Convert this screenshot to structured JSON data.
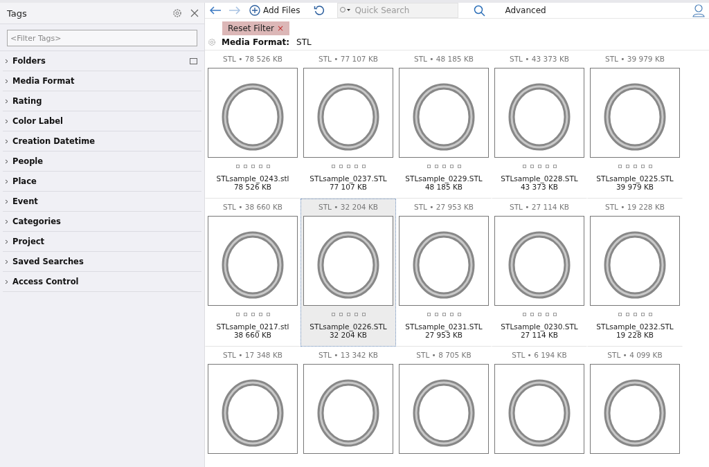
{
  "sidebar": {
    "title": "Tags",
    "filter_placeholder": "<Filter Tags>",
    "groups": [
      {
        "label": "Folders",
        "expanded": false
      },
      {
        "label": "Media Format",
        "expanded": false
      },
      {
        "label": "Rating",
        "expanded": false
      },
      {
        "label": "Color Label",
        "expanded": false
      },
      {
        "label": "Creation Datetime",
        "expanded": false
      },
      {
        "label": "People",
        "expanded": false
      },
      {
        "label": "Place",
        "expanded": false
      },
      {
        "label": "Event",
        "expanded": false
      },
      {
        "label": "Categories",
        "expanded": false
      },
      {
        "label": "Project",
        "expanded": false
      },
      {
        "label": "Saved Searches",
        "expanded": false
      },
      {
        "label": "Access Control",
        "expanded": false
      }
    ]
  },
  "toolbar": {
    "add_files": "Add Files",
    "search_placeholder": "Quick Search",
    "advanced": "Advanced"
  },
  "filter": {
    "reset": "Reset Filter",
    "close": "×",
    "label": "Media Format:",
    "value": "STL"
  },
  "items": [
    {
      "header": "STL • 78 526 KB",
      "name": "STLsample_0243.stl",
      "size": "78 526 KB",
      "stars": 0,
      "selected": false
    },
    {
      "header": "STL • 77 107 KB",
      "name": "STLsample_0237.STL",
      "size": "77 107 KB",
      "stars": 0,
      "selected": false
    },
    {
      "header": "STL • 48 185 KB",
      "name": "STLsample_0229.STL",
      "size": "48 185 KB",
      "stars": 0,
      "selected": false
    },
    {
      "header": "STL • 43 373 KB",
      "name": "STLsample_0228.STL",
      "size": "43 373 KB",
      "stars": 0,
      "selected": false
    },
    {
      "header": "STL • 39 979 KB",
      "name": "STLsample_0225.STL",
      "size": "39 979 KB",
      "stars": 0,
      "selected": false
    },
    {
      "header": "STL • 38 660 KB",
      "name": "STLsample_0217.stl",
      "size": "38 660 KB",
      "stars": 0,
      "selected": false
    },
    {
      "header": "STL • 32 204 KB",
      "name": "STLsample_0226.STL",
      "size": "32 204 KB",
      "stars": 0,
      "selected": true
    },
    {
      "header": "STL • 27 953 KB",
      "name": "STLsample_0231.STL",
      "size": "27 953 KB",
      "stars": 0,
      "selected": false
    },
    {
      "header": "STL • 27 114 KB",
      "name": "STLsample_0230.STL",
      "size": "27 114 KB",
      "stars": 0,
      "selected": false
    },
    {
      "header": "STL • 19 228 KB",
      "name": "STLsample_0232.STL",
      "size": "19 228 KB",
      "stars": 0,
      "selected": false
    },
    {
      "header": "STL • 17 348 KB",
      "selected": false
    },
    {
      "header": "STL • 13 342 KB",
      "selected": false
    },
    {
      "header": "STL • 8 705 KB",
      "selected": false
    },
    {
      "header": "STL • 6 194 KB",
      "selected": false
    },
    {
      "header": "STL • 4 099 KB",
      "selected": false
    }
  ]
}
